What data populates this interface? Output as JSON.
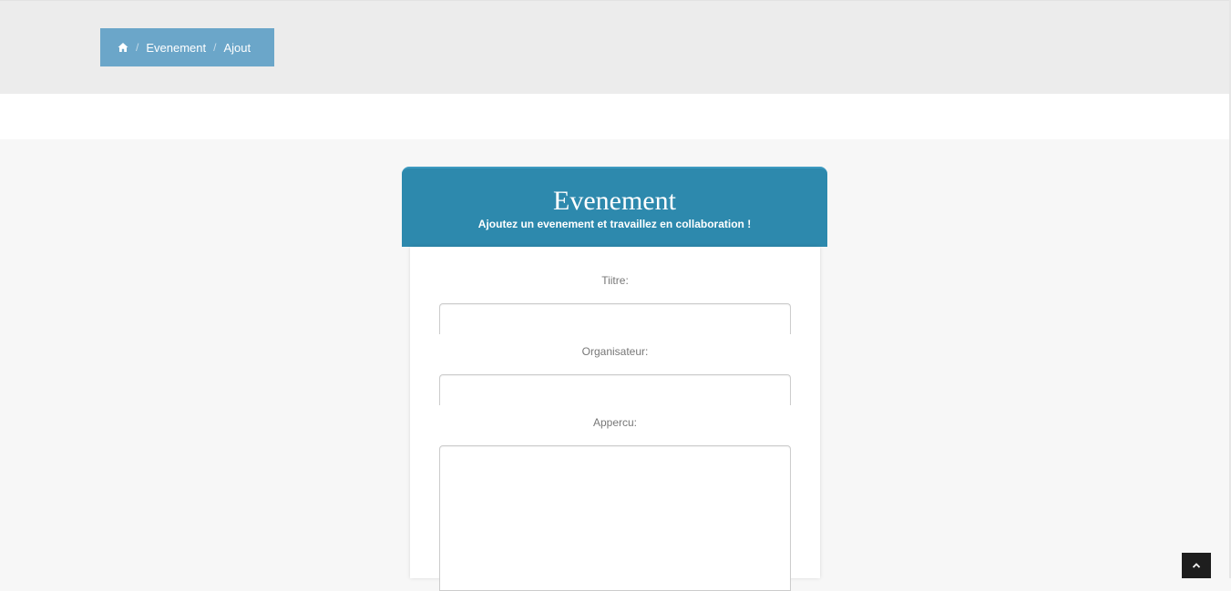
{
  "breadcrumb": {
    "home_icon": "home-icon",
    "separator": "/",
    "items": [
      {
        "label": "Evenement"
      },
      {
        "label": "Ajout"
      }
    ],
    "background": "#6ba6c9"
  },
  "card": {
    "title": "Evenement",
    "subtitle": "Ajoutez un evenement et travaillez en collaboration !",
    "header_color": "#2d89ad"
  },
  "form": {
    "titre": {
      "label": "Tiitre:",
      "value": ""
    },
    "organisateur": {
      "label": "Organisateur:",
      "value": ""
    },
    "apercu": {
      "label": "Appercu:",
      "value": ""
    }
  },
  "back_to_top": {
    "icon": "chevron-up-icon"
  }
}
